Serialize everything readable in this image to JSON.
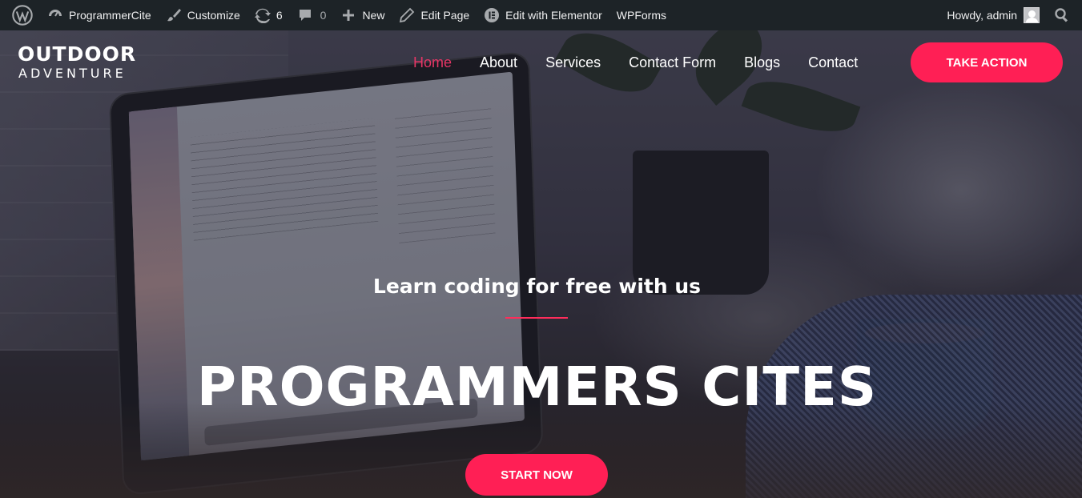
{
  "adminbar": {
    "site_name": "ProgrammerCite",
    "customize": "Customize",
    "updates_count": "6",
    "comments_count": "0",
    "new": "New",
    "edit_page": "Edit Page",
    "elementor": "Edit with Elementor",
    "wpforms": "WPForms",
    "howdy": "Howdy, admin"
  },
  "site": {
    "logo_top": "OUTDOOR",
    "logo_bottom": "ADVENTURE",
    "nav": [
      "Home",
      "About",
      "Services",
      "Contact Form",
      "Blogs",
      "Contact"
    ],
    "active_nav": "Home",
    "cta": "TAKE ACTION"
  },
  "hero": {
    "subtitle": "Learn coding for free with us",
    "title": "PROGRAMMERS CITES",
    "button": "START NOW"
  },
  "colors": {
    "accent": "#ff1f55",
    "active_nav": "#e63565",
    "adminbar_bg": "#1d2327"
  }
}
